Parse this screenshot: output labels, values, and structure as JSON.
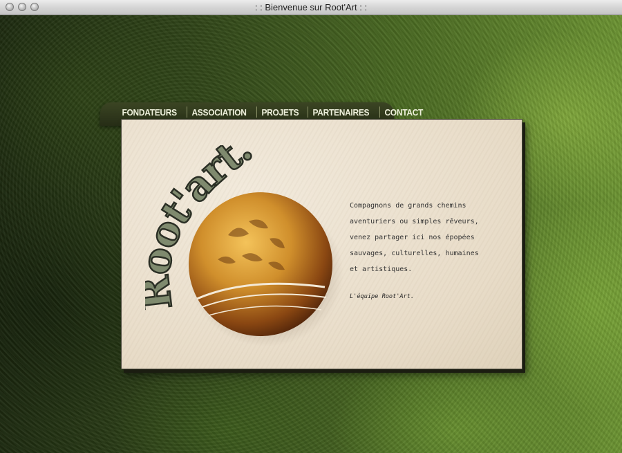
{
  "window": {
    "title": ": : Bienvenue sur Root'Art : :"
  },
  "nav": {
    "items": [
      "FONDATEURS",
      "ASSOCIATION",
      "PROJETS",
      "PARTENAIRES",
      "CONTACT"
    ]
  },
  "logo": {
    "text": "Root'art..."
  },
  "intro": {
    "lines": [
      "Compagnons de grands chemins",
      "aventuriers ou simples rêveurs,",
      "venez partager ici nos épopées",
      "sauvages, culturelles, humaines",
      "et artistiques."
    ],
    "signature": "L'équipe Root'Art."
  },
  "colors": {
    "nav_bg": "#2f3719",
    "card_bg": "#e9ded0",
    "sphere": "#c78a2a"
  }
}
